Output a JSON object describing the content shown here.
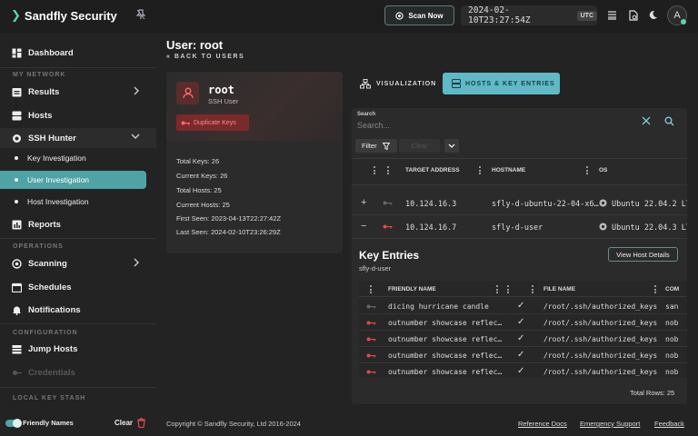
{
  "app": {
    "brand": "Sandfly Security",
    "scan_now": "Scan Now",
    "clock": "2024-02-10T23:27:54Z",
    "timezone": "UTC",
    "avatar_letter": "A"
  },
  "sidebar": {
    "dashboard": "Dashboard",
    "section_network": "MY NETWORK",
    "results": "Results",
    "hosts": "Hosts",
    "ssh_hunter": "SSH Hunter",
    "sub_items": [
      "Key Investigation",
      "User Investigation",
      "Host Investigation"
    ],
    "reports": "Reports",
    "section_operations": "OPERATIONS",
    "scanning": "Scanning",
    "schedules": "Schedules",
    "notifications": "Notifications",
    "section_configuration": "CONFIGURATION",
    "jump_hosts": "Jump Hosts",
    "credentials": "Credentials",
    "section_local": "LOCAL KEY STASH",
    "friendly_names": "Friendly Names",
    "clear": "Clear"
  },
  "page": {
    "title": "User: root",
    "back": "« BACK TO USERS"
  },
  "user_card": {
    "name": "root",
    "subtitle": "SSH User",
    "badge": "Duplicate Keys",
    "stats": [
      {
        "label": "Total Keys:",
        "value": "26"
      },
      {
        "label": "Current Keys:",
        "value": "26"
      },
      {
        "label": "Total Hosts:",
        "value": "25"
      },
      {
        "label": "Current Hosts:",
        "value": "25"
      },
      {
        "label": "First Seen:",
        "value": "2023-04-13T22:27:42Z"
      },
      {
        "label": "Last Seen:",
        "value": "2024-02-10T23:26:29Z"
      }
    ]
  },
  "tabs": {
    "visualization": "VISUALIZATION",
    "hosts_keys": "HOSTS & KEY ENTRIES"
  },
  "hosts_panel": {
    "search_label": "Search",
    "search_placeholder": "Search...",
    "filter": "Filter",
    "clear": "Clear",
    "columns": [
      "TARGET ADDRESS",
      "HOSTNAME",
      "OS"
    ],
    "rows": [
      {
        "toggle": "+",
        "address": "10.124.16.3",
        "hostname": "sfly-d-ubuntu-22-04-x6…",
        "os": "Ubuntu 22.04.2 LTS"
      },
      {
        "toggle": "−",
        "address": "10.124.16.7",
        "hostname": "sfly-d-user",
        "os": "Ubuntu 22.04.3 LTS"
      }
    ],
    "key_entries_title": "Key Entries",
    "key_entries_host": "sfly-d-user",
    "view_host_details": "View Host Details",
    "key_columns": [
      "FRIENDLY NAME",
      "FILE NAME",
      "COM"
    ],
    "key_rows": [
      {
        "name": "dicing hurricane candle",
        "file": "/root/.ssh/authorized_keys",
        "comment": "san",
        "dup": false
      },
      {
        "name": "outnumber showcase reflec…",
        "file": "/root/.ssh/authorized_keys",
        "comment": "nob",
        "dup": true
      },
      {
        "name": "outnumber showcase reflec…",
        "file": "/root/.ssh/authorized_keys",
        "comment": "nob",
        "dup": true
      },
      {
        "name": "outnumber showcase reflec…",
        "file": "/root/.ssh/authorized_keys",
        "comment": "nob",
        "dup": true
      },
      {
        "name": "outnumber showcase reflec…",
        "file": "/root/.ssh/authorized_keys",
        "comment": "nob",
        "dup": true
      }
    ],
    "total_rows": "Total Rows: 25"
  },
  "footer": {
    "copyright": "Copyright © Sandfly Security, Ltd 2016-2024",
    "links": [
      "Reference Docs",
      "Emergency Support",
      "Feedback"
    ]
  },
  "colors": {
    "accent": "#4fa3a5",
    "tab_active": "#5fb9c6",
    "danger": "#d04545",
    "brand_caret": "#5bd6a3"
  }
}
